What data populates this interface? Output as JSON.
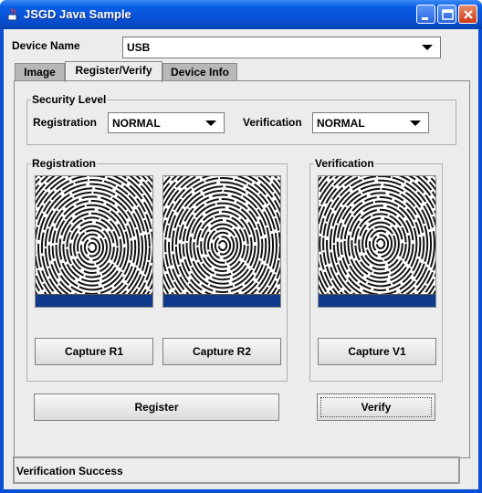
{
  "window": {
    "title": "JSGD Java Sample"
  },
  "device": {
    "label": "Device Name",
    "value": "USB"
  },
  "tabs": [
    {
      "label": "Image",
      "active": false
    },
    {
      "label": "Register/Verify",
      "active": true
    },
    {
      "label": "Device Info",
      "active": false
    }
  ],
  "security": {
    "group_title": "Security Level",
    "registration_label": "Registration",
    "registration_value": "NORMAL",
    "verification_label": "Verification",
    "verification_value": "NORMAL"
  },
  "registration": {
    "group_title": "Registration",
    "capture_r1": "Capture R1",
    "capture_r2": "Capture R2",
    "register": "Register"
  },
  "verification": {
    "group_title": "Verification",
    "capture_v1": "Capture V1",
    "verify": "Verify"
  },
  "status": {
    "text": "Verification Success"
  },
  "colors": {
    "title_bar": "#0a5fe5",
    "fingerprint_bar": "#0f3a8c",
    "background": "#ececec"
  },
  "icons": {
    "app": "java-cup-icon",
    "minimize": "minimize-icon",
    "maximize": "maximize-icon",
    "close": "close-icon"
  }
}
